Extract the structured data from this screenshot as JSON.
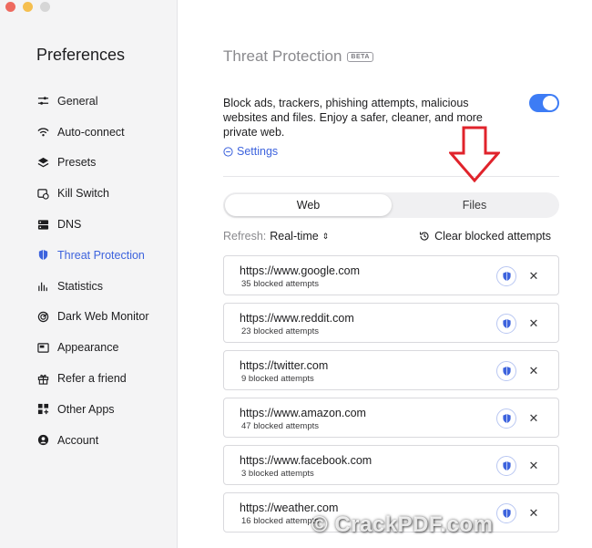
{
  "sidebar": {
    "title": "Preferences",
    "items": [
      {
        "label": "General",
        "icon": "sliders-icon",
        "active": false
      },
      {
        "label": "Auto-connect",
        "icon": "wifi-icon",
        "active": false
      },
      {
        "label": "Presets",
        "icon": "layers-icon",
        "active": false
      },
      {
        "label": "Kill Switch",
        "icon": "kill-switch-icon",
        "active": false
      },
      {
        "label": "DNS",
        "icon": "server-icon",
        "active": false
      },
      {
        "label": "Threat Protection",
        "icon": "shield-icon",
        "active": true
      },
      {
        "label": "Statistics",
        "icon": "bar-chart-icon",
        "active": false
      },
      {
        "label": "Dark Web Monitor",
        "icon": "radar-icon",
        "active": false
      },
      {
        "label": "Appearance",
        "icon": "window-icon",
        "active": false
      },
      {
        "label": "Refer a friend",
        "icon": "gift-icon",
        "active": false
      },
      {
        "label": "Other Apps",
        "icon": "apps-grid-icon",
        "active": false
      },
      {
        "label": "Account",
        "icon": "user-icon",
        "active": false
      }
    ]
  },
  "main": {
    "title": "Threat Protection",
    "badge": "BETA",
    "description": "Block ads, trackers, phishing attempts, malicious websites and files. Enjoy a safer, cleaner, and more private web.",
    "toggle_on": true,
    "settings_label": "Settings",
    "tabs": {
      "web": "Web",
      "files": "Files",
      "selected": "Web"
    },
    "refresh_label": "Refresh:",
    "refresh_value": "Real-time",
    "clear_label": "Clear blocked attempts",
    "sites": [
      {
        "url": "https://www.google.com",
        "count": "35 blocked attempts"
      },
      {
        "url": "https://www.reddit.com",
        "count": "23 blocked attempts"
      },
      {
        "url": "https://twitter.com",
        "count": "9 blocked attempts"
      },
      {
        "url": "https://www.amazon.com",
        "count": "47 blocked attempts"
      },
      {
        "url": "https://www.facebook.com",
        "count": "3 blocked attempts"
      },
      {
        "url": "https://weather.com",
        "count": "16 blocked attempts"
      }
    ]
  },
  "watermark": "© CrackPDF.com",
  "colors": {
    "accent": "#3d63dd",
    "toggle": "#3d7cf5",
    "arrow": "#e0232b"
  }
}
